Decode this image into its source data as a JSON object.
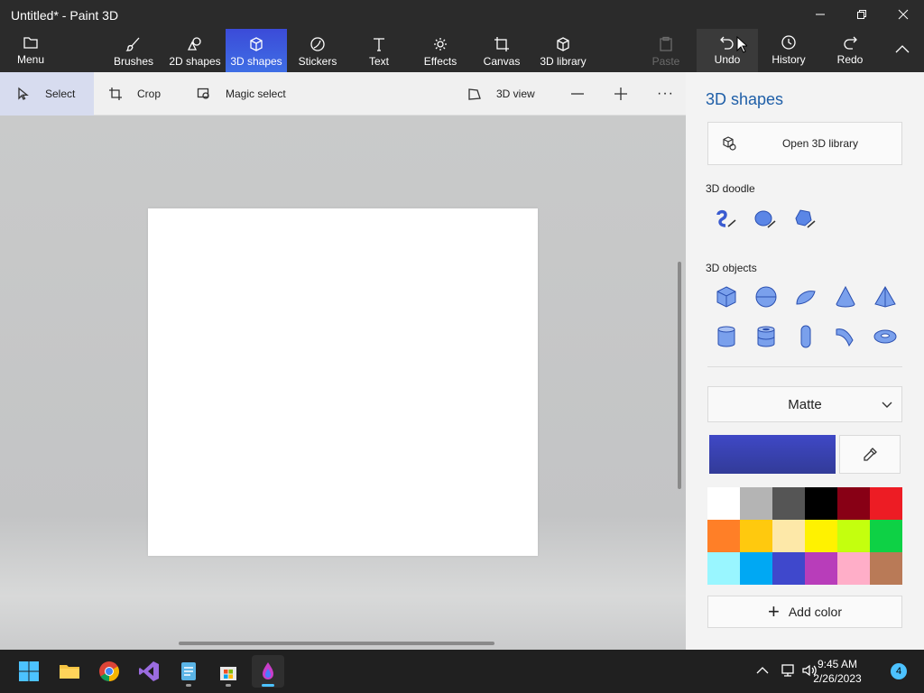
{
  "window": {
    "title": "Untitled* - Paint 3D"
  },
  "ribbon": {
    "menu": "Menu",
    "brushes": "Brushes",
    "shapes2d": "2D shapes",
    "shapes3d": "3D shapes",
    "stickers": "Stickers",
    "text": "Text",
    "effects": "Effects",
    "canvas": "Canvas",
    "library3d": "3D library",
    "paste": "Paste",
    "undo": "Undo",
    "history": "History",
    "redo": "Redo"
  },
  "toolbar": {
    "select": "Select",
    "crop": "Crop",
    "magic_select": "Magic select",
    "view3d": "3D view",
    "more": "···"
  },
  "panel": {
    "title": "3D shapes",
    "open_library": "Open 3D library",
    "doodle_heading": "3D doodle",
    "objects_heading": "3D objects",
    "material": "Matte",
    "add_color": "Add color",
    "current_color": "#3f48c6",
    "palette": [
      "#ffffff",
      "#b4b4b4",
      "#555555",
      "#000000",
      "#880015",
      "#ed1c24",
      "#ff7f27",
      "#ffc90e",
      "#fde8a8",
      "#fff200",
      "#c4ff0e",
      "#0ed145",
      "#99f6ff",
      "#00a8f3",
      "#3f48cc",
      "#b83dba",
      "#ffaec8",
      "#b97a57"
    ]
  },
  "taskbar": {
    "time": "9:45 AM",
    "date": "2/26/2023",
    "notifications": "4"
  }
}
